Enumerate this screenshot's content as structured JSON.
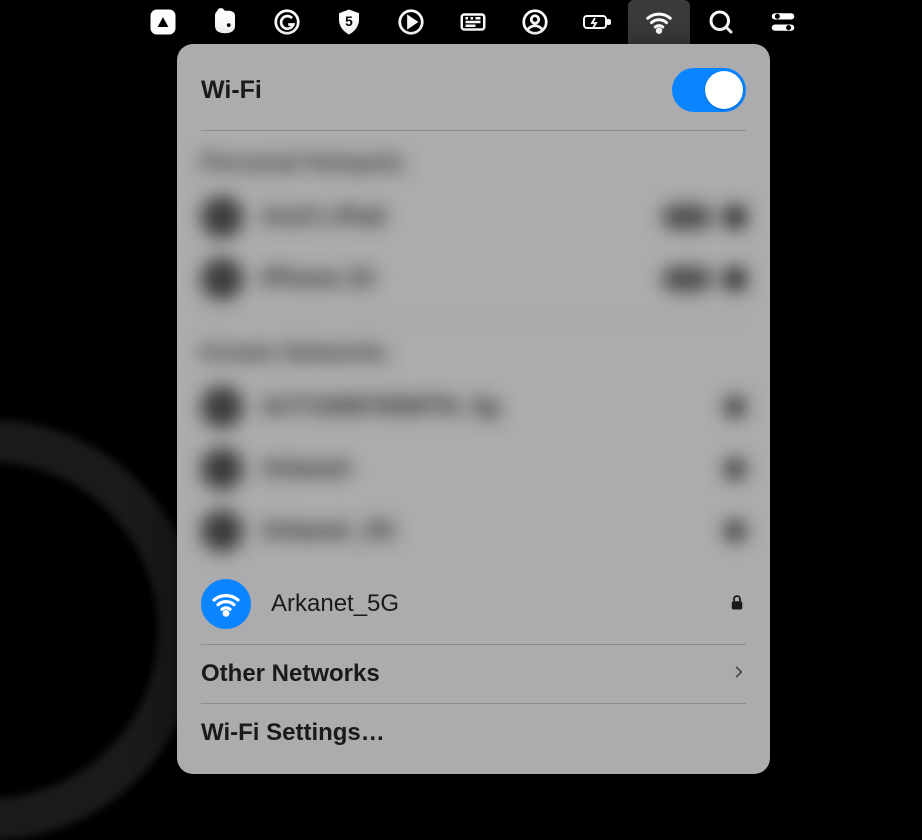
{
  "panel": {
    "title": "Wi-Fi",
    "toggle_on": true,
    "connected_network": "Arkanet_5G",
    "other_networks_label": "Other Networks",
    "settings_label": "Wi-Fi Settings…"
  },
  "blurred_sections": {
    "hotspot_label": "Personal Hotspots",
    "hotspot_items": [
      "Arul's iPad",
      "iPhone 23"
    ],
    "known_label": "Known Networks",
    "known_items": [
      "ACT1008700WTN_5g",
      "Arkanet",
      "Arkanet_2G"
    ]
  },
  "colors": {
    "accent": "#0a84ff",
    "panel_bg": "#acabad"
  }
}
